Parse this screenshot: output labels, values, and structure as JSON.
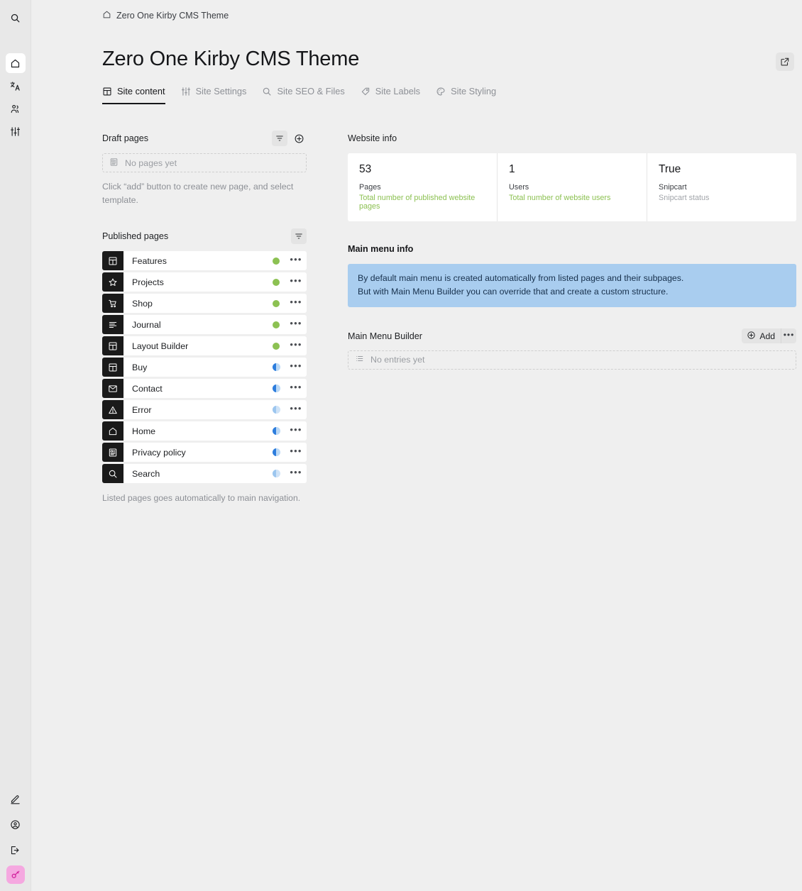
{
  "rail": {
    "search": {
      "name": "search-icon",
      "title": "Search"
    },
    "items": [
      {
        "name": "sidebar-item-home",
        "icon": "home-icon",
        "active": true
      },
      {
        "name": "sidebar-item-languages",
        "icon": "languages-icon",
        "active": false
      },
      {
        "name": "sidebar-item-users",
        "icon": "users-icon",
        "active": false
      },
      {
        "name": "sidebar-item-system",
        "icon": "sliders-icon",
        "active": false
      }
    ],
    "bottom": [
      {
        "name": "sidebar-item-edit",
        "icon": "pencil-icon"
      },
      {
        "name": "sidebar-item-account",
        "icon": "account-icon"
      },
      {
        "name": "sidebar-item-logout",
        "icon": "logout-icon"
      }
    ],
    "avatar": {
      "name": "avatar",
      "icon": "key-icon",
      "color": "#f5a8e0"
    }
  },
  "breadcrumb": {
    "icon": "home-icon",
    "label": "Zero One Kirby CMS Theme"
  },
  "header": {
    "title": "Zero One Kirby CMS Theme",
    "open_icon": "external-link-icon"
  },
  "tabs": [
    {
      "label": "Site content",
      "icon": "layout-icon",
      "active": true
    },
    {
      "label": "Site Settings",
      "icon": "sliders-icon",
      "active": false
    },
    {
      "label": "Site SEO & Files",
      "icon": "search-icon",
      "active": false
    },
    {
      "label": "Site Labels",
      "icon": "tag-icon",
      "active": false
    },
    {
      "label": "Site Styling",
      "icon": "palette-icon",
      "active": false
    }
  ],
  "draft_pages": {
    "title": "Draft pages",
    "filter_icon": "filter-icon",
    "add_icon": "plus-circle-icon",
    "empty_icon": "page-icon",
    "empty_text": "No pages yet",
    "helper": "Click “add” button to create new page, and select template."
  },
  "published_pages": {
    "title": "Published pages",
    "filter_icon": "filter-icon",
    "footnote": "Listed pages goes automatically to main navigation.",
    "options_icon": "ellipsis-icon",
    "items": [
      {
        "label": "Features",
        "icon": "layout-icon",
        "status": "listed"
      },
      {
        "label": "Projects",
        "icon": "star-icon",
        "status": "listed"
      },
      {
        "label": "Shop",
        "icon": "cart-icon",
        "status": "listed"
      },
      {
        "label": "Journal",
        "icon": "list-icon",
        "status": "listed"
      },
      {
        "label": "Layout Builder",
        "icon": "layout-icon",
        "status": "listed"
      },
      {
        "label": "Buy",
        "icon": "layout-icon",
        "status": "unlisted"
      },
      {
        "label": "Contact",
        "icon": "mail-icon",
        "status": "unlisted"
      },
      {
        "label": "Error",
        "icon": "alert-icon",
        "status": "unlisted-pale"
      },
      {
        "label": "Home",
        "icon": "home-icon",
        "status": "unlisted"
      },
      {
        "label": "Privacy policy",
        "icon": "document-icon",
        "status": "unlisted"
      },
      {
        "label": "Search",
        "icon": "search-icon",
        "status": "unlisted-pale"
      }
    ]
  },
  "website_info": {
    "title": "Website info",
    "cards": [
      {
        "value": "53",
        "label": "Pages",
        "help": "Total number of published website pages",
        "help_muted": false
      },
      {
        "value": "1",
        "label": "Users",
        "help": "Total number of website users",
        "help_muted": false
      },
      {
        "value": "True",
        "label": "Snipcart",
        "help": "Snipcart status",
        "help_muted": true
      }
    ]
  },
  "main_menu": {
    "info_title": "Main menu info",
    "banner_line1": "By default main menu is created automatically from listed pages and their subpages.",
    "banner_line2": "But with Main Menu Builder you can override that and create a custom structure.",
    "banner_color": "#a9cdef",
    "builder_title": "Main Menu Builder",
    "add_label": "Add",
    "add_icon": "plus-circle-icon",
    "more_icon": "ellipsis-icon",
    "empty_icon": "list-icon",
    "empty_text": "No entries yet"
  },
  "colors": {
    "background": "#efefef",
    "rail": "#e8e8e8",
    "listed_dot": "#8cc152",
    "unlisted_dot": "#2d7ddd",
    "accent_green": "#8cc152"
  }
}
